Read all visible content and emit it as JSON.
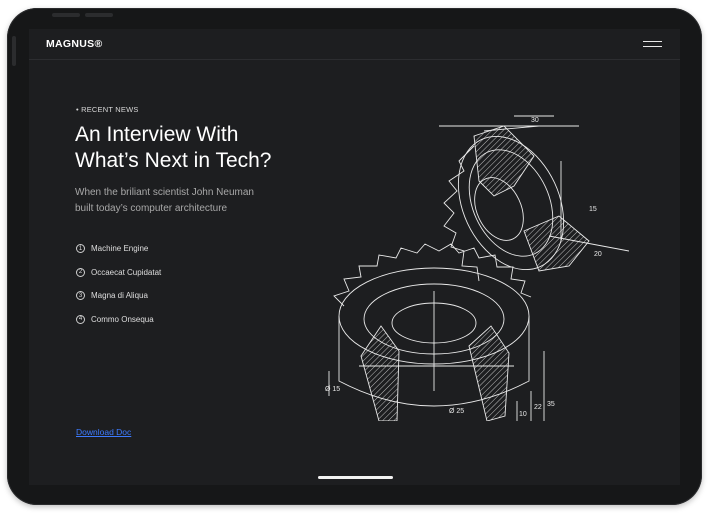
{
  "app": {
    "brand": "MAGNUS®"
  },
  "header": {
    "menu_icon": "hamburger-menu-icon"
  },
  "hero": {
    "kicker": "• RECENT NEWS",
    "title_line1": "An Interview With",
    "title_line2": "What’s Next in Tech?",
    "subtitle_line1": "When the briliant scientist John Neuman",
    "subtitle_line2": "built today’s computer architecture"
  },
  "list": {
    "items": [
      {
        "number": "1",
        "label": "Machine Engine"
      },
      {
        "number": "2",
        "label": "Occaecat Cupidatat"
      },
      {
        "number": "3",
        "label": "Magna di Aliqua"
      },
      {
        "number": "4",
        "label": "Commo Onsequa"
      }
    ]
  },
  "download": {
    "label": "Download Doc"
  },
  "drawing": {
    "dimensions": [
      "30",
      "15",
      "20",
      "35",
      "22",
      "10",
      "Ø 25",
      "Ø 15"
    ]
  },
  "colors": {
    "background": "#1d1e20",
    "text": "#ffffff",
    "link": "#3d7bff",
    "muted": "#a8a8a8"
  }
}
